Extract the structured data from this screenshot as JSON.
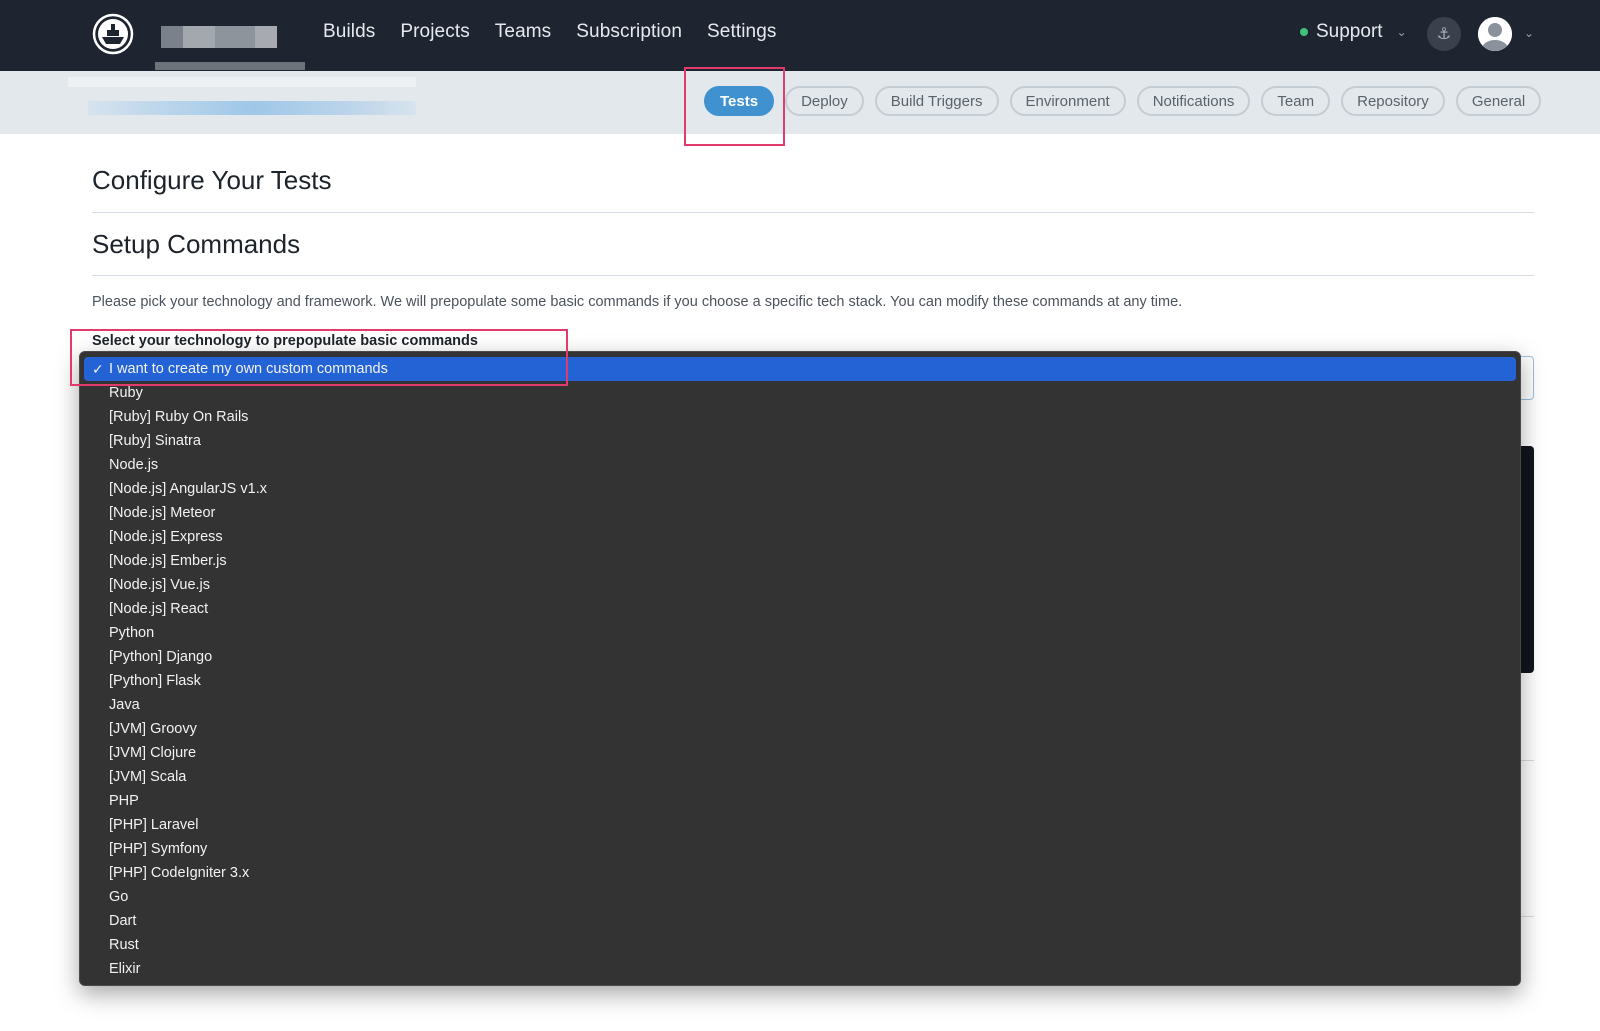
{
  "nav": {
    "links": [
      "Builds",
      "Projects",
      "Teams",
      "Subscription",
      "Settings"
    ],
    "support_label": "Support"
  },
  "project_tabs": [
    "Tests",
    "Deploy",
    "Build Triggers",
    "Environment",
    "Notifications",
    "Team",
    "Repository",
    "General"
  ],
  "active_tab": "Tests",
  "page": {
    "title": "Configure Your Tests",
    "section_title": "Setup Commands",
    "description": "Please pick your technology and framework. We will prepopulate some basic commands if you choose a specific tech stack. You can modify these commands at any time.",
    "select_label": "Select your technology to prepopulate basic commands"
  },
  "technology_options": [
    "I want to create my own custom commands",
    "Ruby",
    "[Ruby] Ruby On Rails",
    "[Ruby] Sinatra",
    "Node.js",
    "[Node.js] AngularJS v1.x",
    "[Node.js] Meteor",
    "[Node.js] Express",
    "[Node.js] Ember.js",
    "[Node.js] Vue.js",
    "[Node.js] React",
    "Python",
    "[Python] Django",
    "[Python] Flask",
    "Java",
    "[JVM] Groovy",
    "[JVM] Clojure",
    "[JVM] Scala",
    "PHP",
    "[PHP] Laravel",
    "[PHP] Symfony",
    "[PHP] CodeIgniter 3.x",
    "Go",
    "Dart",
    "Rust",
    "Elixir"
  ],
  "selected_option": "I want to create my own custom commands",
  "colors": {
    "nav_bg": "#1f2530",
    "subbar_bg": "#e3e8ed",
    "active_tab": "#3f91cf",
    "dropdown_bg": "#333333",
    "selected_option": "#2463d6",
    "highlight": "#e23b6b"
  },
  "icons": [
    "ship-logo-icon",
    "status-dot-icon",
    "chevron-down-icon",
    "anchor-icon",
    "user-avatar-icon",
    "checkmark-icon"
  ]
}
